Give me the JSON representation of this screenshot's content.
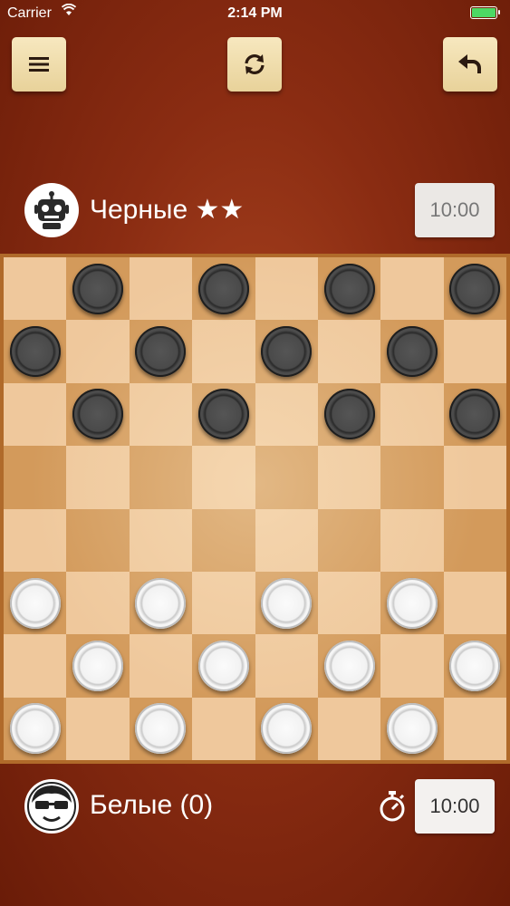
{
  "status_bar": {
    "carrier": "Carrier",
    "time": "2:14 PM"
  },
  "toolbar": {
    "menu_icon": "menu-icon",
    "restart_icon": "refresh-icon",
    "undo_icon": "undo-icon"
  },
  "players": {
    "top": {
      "name": "Черные ★★",
      "clock": "10:00",
      "avatar": "robot-icon"
    },
    "bottom": {
      "name": "Белые (0)",
      "clock": "10:00",
      "avatar": "person-glasses-icon",
      "timer_icon": "stopwatch-icon"
    }
  },
  "board": {
    "size": 8,
    "pieces": [
      {
        "color": "black",
        "row": 0,
        "col": 1
      },
      {
        "color": "black",
        "row": 0,
        "col": 3
      },
      {
        "color": "black",
        "row": 0,
        "col": 5
      },
      {
        "color": "black",
        "row": 0,
        "col": 7
      },
      {
        "color": "black",
        "row": 1,
        "col": 0
      },
      {
        "color": "black",
        "row": 1,
        "col": 2
      },
      {
        "color": "black",
        "row": 1,
        "col": 4
      },
      {
        "color": "black",
        "row": 1,
        "col": 6
      },
      {
        "color": "black",
        "row": 2,
        "col": 1
      },
      {
        "color": "black",
        "row": 2,
        "col": 3
      },
      {
        "color": "black",
        "row": 2,
        "col": 5
      },
      {
        "color": "black",
        "row": 2,
        "col": 7
      },
      {
        "color": "white",
        "row": 5,
        "col": 0
      },
      {
        "color": "white",
        "row": 5,
        "col": 2
      },
      {
        "color": "white",
        "row": 5,
        "col": 4
      },
      {
        "color": "white",
        "row": 5,
        "col": 6
      },
      {
        "color": "white",
        "row": 6,
        "col": 1
      },
      {
        "color": "white",
        "row": 6,
        "col": 3
      },
      {
        "color": "white",
        "row": 6,
        "col": 5
      },
      {
        "color": "white",
        "row": 6,
        "col": 7
      },
      {
        "color": "white",
        "row": 7,
        "col": 0
      },
      {
        "color": "white",
        "row": 7,
        "col": 2
      },
      {
        "color": "white",
        "row": 7,
        "col": 4
      },
      {
        "color": "white",
        "row": 7,
        "col": 6
      }
    ]
  }
}
